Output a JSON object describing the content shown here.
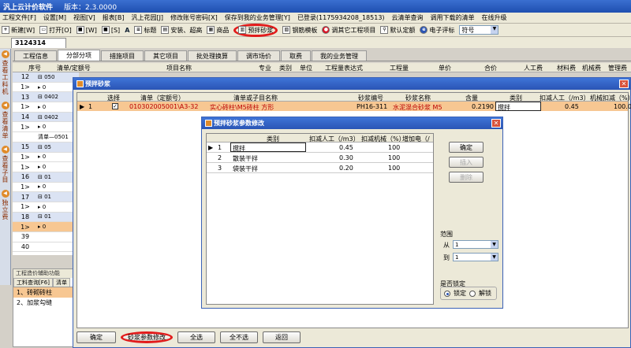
{
  "app": {
    "title": "汎上云计价软件",
    "version": "版本：2.3.0000"
  },
  "menu": [
    "工程文件[F]",
    "设置[M]",
    "视图[V]",
    "报表[B]",
    "汎上花园[J]",
    "修改账号密码[X]",
    "保存到我的业务管理[Y]",
    "已登录(1175934208_18513)",
    "云清单查询",
    "调用下载的清单",
    "在线升级"
  ],
  "toolbar": {
    "items": [
      "新建[W]",
      "打开[O]",
      "[W]",
      "[S]",
      "A",
      "标题",
      "安装、超高",
      "商品",
      "预拌砂浆",
      "钢筋模板",
      "调其它工程项目",
      "默认定额",
      "电子评标"
    ],
    "combo_value": "符号"
  },
  "doc_tab": "3124314",
  "left_strip": [
    "查看工料机",
    "查看清单",
    "查看子目",
    "独立费"
  ],
  "main_tabs": [
    "工程信息",
    "分部分项",
    "措施项目",
    "其它项目",
    "批处理换算",
    "调市场价",
    "取费",
    "我的业务管理"
  ],
  "active_main_tab": "分部分项",
  "grid_header": [
    "序号",
    "清单/定额号",
    "项目名称",
    "专业",
    "类别",
    "单位",
    "工程量表达式",
    "工程量",
    "单价",
    "合价",
    "人工费",
    "材料费",
    "机械费",
    "管理费"
  ],
  "grid_rows": [
    {
      "num": "12",
      "code": "⊟ 050"
    },
    {
      "num": "1>",
      "code": "▸ 0"
    },
    {
      "num": "13",
      "code": "⊟ 0402"
    },
    {
      "num": "1>",
      "code": "▸ 0"
    },
    {
      "num": "14",
      "code": "⊟ 0402"
    },
    {
      "num": "1>",
      "code": "▸ 0"
    },
    {
      "num": "",
      "code": "清单—0501"
    },
    {
      "num": "15",
      "code": "⊟ 05"
    },
    {
      "num": "1>",
      "code": "▸ 0"
    },
    {
      "num": "1>",
      "code": "▸ 0"
    },
    {
      "num": "16",
      "code": "⊟ 01"
    },
    {
      "num": "1>",
      "code": "▸ 0"
    },
    {
      "num": "17",
      "code": "⊟ 01"
    },
    {
      "num": "1>",
      "code": "▸ 0"
    },
    {
      "num": "18",
      "code": "⊟ 01"
    },
    {
      "num": "1>",
      "code": "▸ 0"
    },
    {
      "num": "39",
      "code": ""
    },
    {
      "num": "40",
      "code": ""
    }
  ],
  "aux": {
    "title": "工程造价辅助功能",
    "tabs": [
      "工料查询[F6]",
      "清单"
    ],
    "items": [
      "1、砖砌砖柱",
      "2、加浆勾缝"
    ]
  },
  "mix_dialog": {
    "title": "预拌砂浆",
    "headers": [
      "选择",
      "清单（定额号）",
      "清单或子目名称",
      "砂浆编号",
      "砂浆名称",
      "含量",
      "类别",
      "扣减人工（/m3）",
      "机械扣减（%）"
    ],
    "row": {
      "idx": "1",
      "code": "010302005001\\A3-32",
      "name": "实心砖柱\\M5砖柱 方形",
      "mortar_code": "PH16-311",
      "mortar_name": "水泥混合砂浆 M5",
      "qty": "0.2190",
      "category": "搅拌",
      "labor": "0.45",
      "mech": "100.0"
    },
    "buttons": [
      "确定",
      "砂浆参数修改",
      "全选",
      "全不选",
      "返回"
    ]
  },
  "param_dialog": {
    "title": "预拌砂浆参数修改",
    "headers": [
      "类别",
      "扣减人工（/m3）",
      "扣减机械（%）",
      "增加电（/"
    ],
    "rows": [
      {
        "n": "1",
        "cat": "搅拌",
        "labor": "0.45",
        "mech": "100"
      },
      {
        "n": "2",
        "cat": "散装干拌",
        "labor": "0.30",
        "mech": "100"
      },
      {
        "n": "3",
        "cat": "袋装干拌",
        "labor": "0.20",
        "mech": "100"
      }
    ],
    "buttons": {
      "ok": "确定",
      "insert": "插入",
      "delete": "删除"
    },
    "range": {
      "label": "范围",
      "from_label": "从",
      "to_label": "到",
      "from": "1",
      "to": "1"
    },
    "lock": {
      "label": "是否锁定",
      "options": [
        "锁定",
        "解锁"
      ],
      "selected": "锁定"
    }
  }
}
